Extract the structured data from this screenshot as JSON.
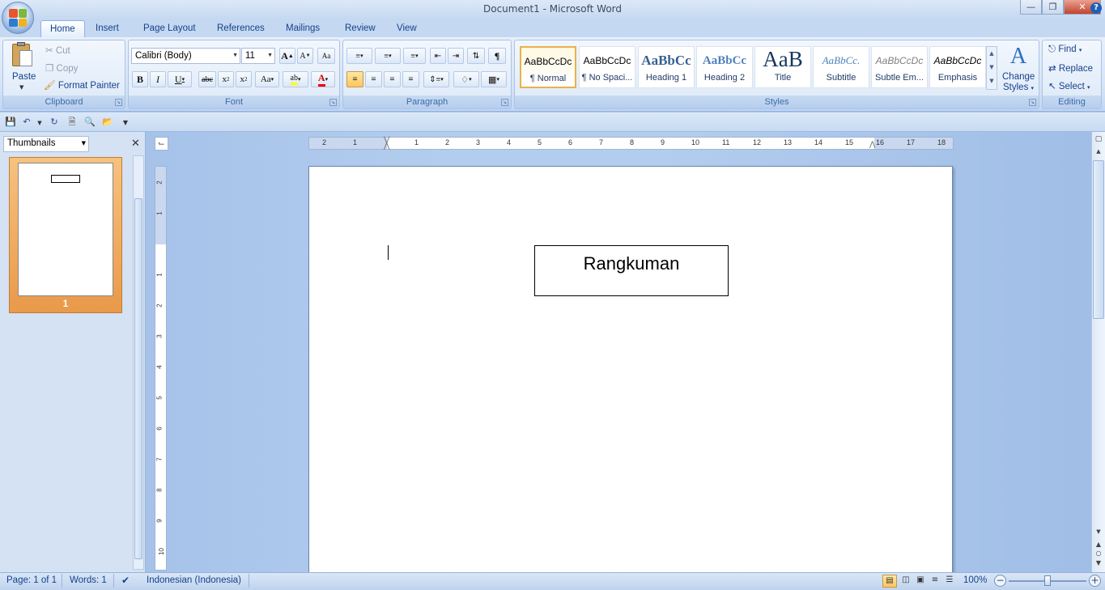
{
  "window": {
    "title": "Document1 - Microsoft Word"
  },
  "tabs": [
    "Home",
    "Insert",
    "Page Layout",
    "References",
    "Mailings",
    "Review",
    "View"
  ],
  "clipboard": {
    "paste": "Paste",
    "cut": "Cut",
    "copy": "Copy",
    "format_painter": "Format Painter",
    "label": "Clipboard"
  },
  "font": {
    "name": "Calibri (Body)",
    "size": "11",
    "label": "Font"
  },
  "paragraph": {
    "label": "Paragraph"
  },
  "styles": {
    "items": [
      {
        "sample": "AaBbCcDc",
        "name": "¶ Normal"
      },
      {
        "sample": "AaBbCcDc",
        "name": "¶ No Spaci..."
      },
      {
        "sample": "AaBbCc",
        "name": "Heading 1"
      },
      {
        "sample": "AaBbCc",
        "name": "Heading 2"
      },
      {
        "sample": "AaB",
        "name": "Title"
      },
      {
        "sample": "AaBbCc.",
        "name": "Subtitle"
      },
      {
        "sample": "AaBbCcDc",
        "name": "Subtle Em..."
      },
      {
        "sample": "AaBbCcDc",
        "name": "Emphasis"
      }
    ],
    "change": "Change",
    "change2": "Styles",
    "label": "Styles"
  },
  "editing": {
    "find": "Find",
    "replace": "Replace",
    "select": "Select",
    "label": "Editing"
  },
  "thumbnails": {
    "title": "Thumbnails",
    "page_number": "1"
  },
  "document": {
    "textbox": "Rangkuman"
  },
  "status": {
    "page": "Page: 1 of 1",
    "words": "Words: 1",
    "language": "Indonesian (Indonesia)",
    "zoom": "100%"
  },
  "ruler": {
    "h_labels": [
      "2",
      "1",
      "1",
      "2",
      "3",
      "4",
      "5",
      "6",
      "7",
      "8",
      "9",
      "10",
      "11",
      "12",
      "13",
      "14",
      "15",
      "16",
      "17",
      "18"
    ],
    "v_labels": [
      "2",
      "1",
      "1",
      "2",
      "3",
      "4",
      "5",
      "6",
      "7",
      "8",
      "9",
      "10"
    ]
  },
  "colors": {
    "accent": "#15428b",
    "ribbon": "#dde9f8",
    "highlight": "#ffc65e"
  }
}
